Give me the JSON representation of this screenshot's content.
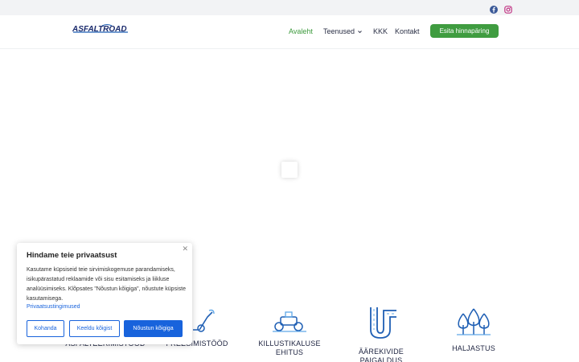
{
  "topbar": {
    "social": [
      {
        "icon": "facebook-icon",
        "color": "#3b5998"
      },
      {
        "icon": "instagram-icon",
        "color": "#c13584"
      }
    ]
  },
  "header": {
    "logo_text": "ASFALTROAD",
    "nav": [
      {
        "label": "Avaleht",
        "active": true
      },
      {
        "label": "Teenused",
        "has_dropdown": true
      },
      {
        "label": "KKK"
      },
      {
        "label": "Kontakt"
      }
    ],
    "cta_label": "Esita hinnapäring"
  },
  "services": [
    {
      "label": "ASFALTEERIMISTÖÖD",
      "icon": "paving-icon"
    },
    {
      "label": "FREESIMISTÖÖD",
      "icon": "milling-icon"
    },
    {
      "label": "KILLUSTIKALUSE EHITUS",
      "icon": "roller-icon"
    },
    {
      "label": "ÄÄREKIVIDE PAIGALDUS",
      "icon": "curb-road-icon"
    },
    {
      "label": "HALJASTUS",
      "icon": "trees-icon"
    }
  ],
  "cookie": {
    "title": "Hindame teie privaatsust",
    "text": "Kasutame küpsiseid teie sirvimiskogemuse parandamiseks, isikupärastatud reklaamide või sisu esitamiseks ja liikluse analüüsimiseks. Klõpsates \"Nõustun kõigiga\", nõustute küpsiste kasutamisega.",
    "link": "Privaatsustingimused",
    "buttons": {
      "customize": "Kohanda",
      "reject": "Keeldu kõigist",
      "accept": "Nõustun kõigiga"
    }
  },
  "colors": {
    "accent_green": "#3f9c40",
    "cookie_blue": "#1863dc",
    "icon_blue": "#1f5fb4",
    "topbar_bg": "#f2f3f5"
  }
}
